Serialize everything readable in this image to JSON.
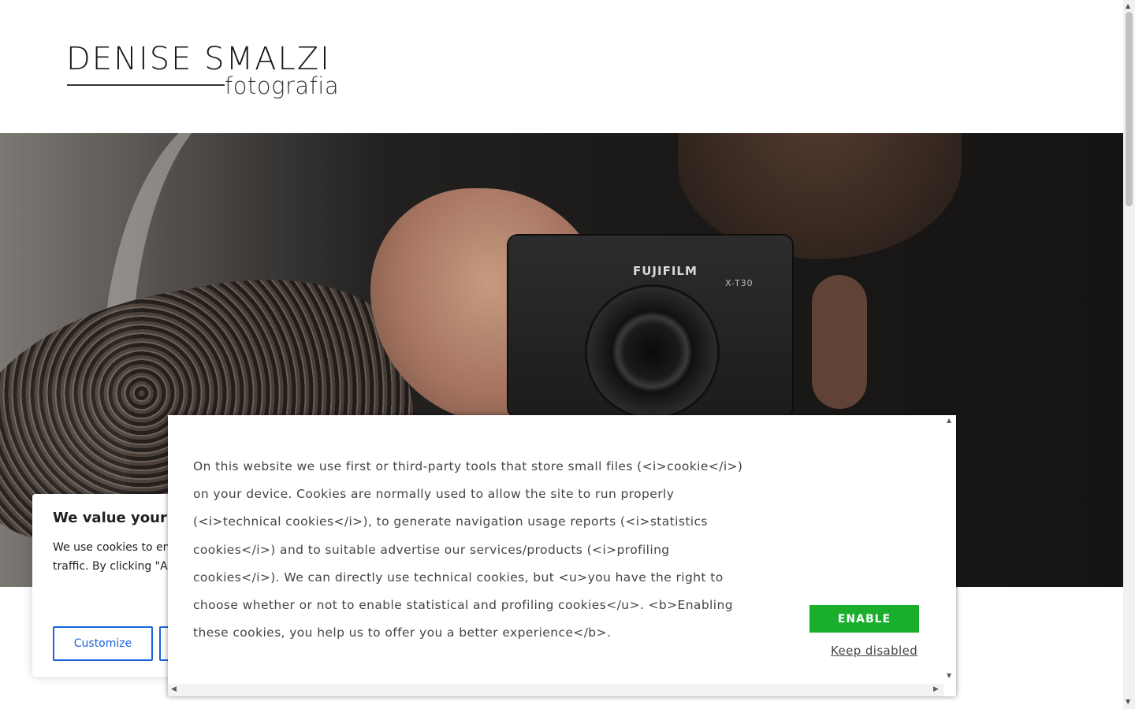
{
  "logo": {
    "name": "DENISE SMALZI",
    "subtitle": "fotografia"
  },
  "hero": {
    "camera_brand": "FUJIFILM",
    "camera_model": "X-T30"
  },
  "consent_card": {
    "title": "We value your",
    "body": "We use cookies to en serve personalized a traffic. By clicking \"A of cookies.",
    "customize_label": "Customize"
  },
  "cookie_modal": {
    "text": "On this website we use first or third-party tools that store small files (<i>cookie</i>) on your device. Cookies are normally used to allow the site to run properly (<i>technical cookies</i>), to generate navigation usage reports (<i>statistics cookies</i>) and to suitable advertise our services/products (<i>profiling cookies</i>). We can directly use technical cookies, but <u>you have the right to choose whether or not to enable statistical and profiling cookies</u>. <b>Enabling these cookies, you help us to offer you a better experience</b>.",
    "enable_label": "ENABLE",
    "keep_disabled_label": "Keep disabled"
  },
  "colors": {
    "enable_button": "#19ae2b",
    "customize_border": "#1863dc"
  },
  "icons": {
    "scroll_up": "▲",
    "scroll_down": "▼",
    "scroll_left": "◀",
    "scroll_right": "▶"
  }
}
